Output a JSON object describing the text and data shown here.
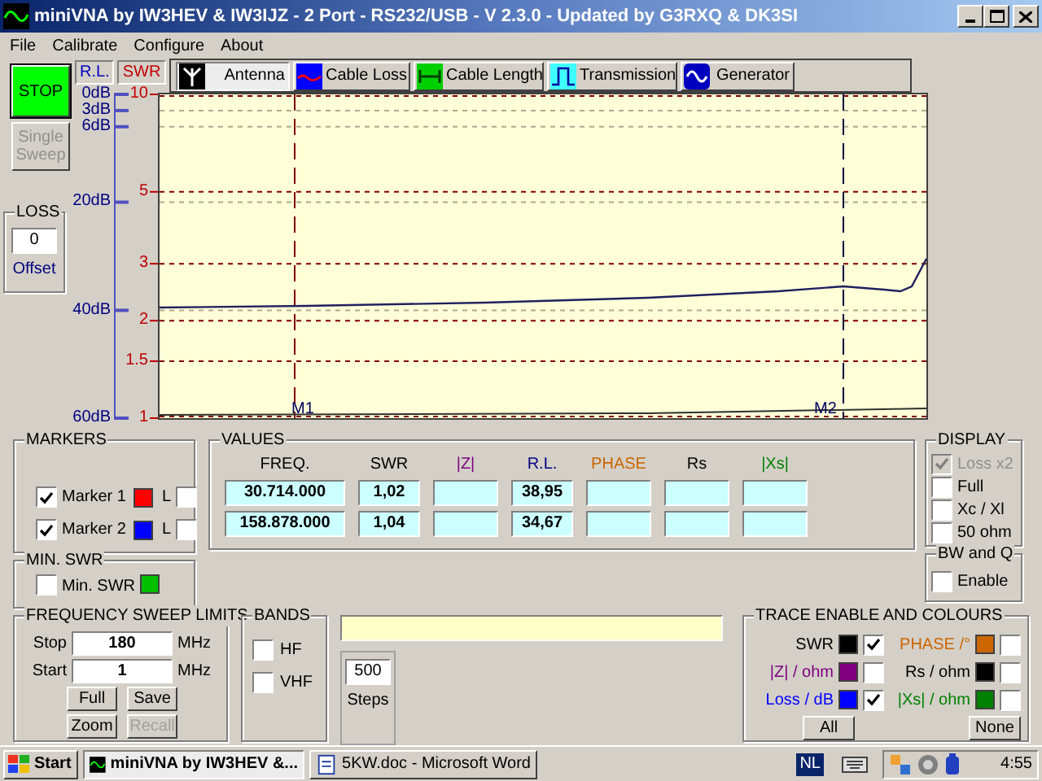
{
  "window": {
    "title": "miniVNA by IW3HEV & IW3IJZ - 2 Port - RS232/USB - V 2.3.0 - Updated by G3RXQ & DK3SI"
  },
  "menu": [
    "File",
    "Calibrate",
    "Configure",
    "About"
  ],
  "stop_button": "STOP",
  "single_sweep": {
    "label": "Single Sweep",
    "disabled": true
  },
  "loss": {
    "title": "LOSS",
    "value": "0",
    "caption": "Offset"
  },
  "scale_buttons": [
    {
      "label": "R.L.",
      "color": "#0000c0"
    },
    {
      "label": "SWR",
      "color": "#c00000"
    }
  ],
  "tabs": [
    {
      "label": "Antenna",
      "kind": "antenna",
      "selected": true
    },
    {
      "label": "Cable Loss",
      "kind": "loss",
      "selected": false
    },
    {
      "label": "Cable Length",
      "kind": "length",
      "selected": false
    },
    {
      "label": "Transmission",
      "kind": "transmission",
      "selected": false
    },
    {
      "label": "Generator",
      "kind": "generator",
      "selected": false
    }
  ],
  "chart": {
    "rl_ticks": [
      "0dB",
      "3dB",
      "6dB",
      "20dB",
      "40dB",
      "60dB"
    ],
    "swr_ticks": [
      "10",
      "5",
      "3",
      "2",
      "1.5",
      "1"
    ],
    "markers": [
      "M1",
      "M2"
    ]
  },
  "markers": {
    "title": "MARKERS",
    "items": [
      {
        "label": "Marker 1",
        "checked": true,
        "color": "#ff0000",
        "l_label": "L",
        "l_checked": false
      },
      {
        "label": "Marker 2",
        "checked": true,
        "color": "#0000ff",
        "l_label": "L",
        "l_checked": false
      }
    ]
  },
  "min_swr": {
    "title": "MIN. SWR",
    "label": "Min. SWR",
    "checked": false,
    "color": "#00c000"
  },
  "values": {
    "title": "VALUES",
    "columns": [
      {
        "label": "FREQ.",
        "color": "#000000"
      },
      {
        "label": "SWR",
        "color": "#000000"
      },
      {
        "label": "|Z|",
        "color": "#800080"
      },
      {
        "label": "R.L.",
        "color": "#000080"
      },
      {
        "label": "PHASE",
        "color": "#cc6600"
      },
      {
        "label": "Rs",
        "color": "#000000"
      },
      {
        "label": "|Xs|",
        "color": "#008000"
      }
    ],
    "rows": [
      [
        "30.714.000",
        "1,02",
        null,
        "38,95",
        null,
        null,
        null
      ],
      [
        "158.878.000",
        "1,04",
        null,
        "34,67",
        null,
        null,
        null
      ]
    ]
  },
  "display": {
    "title": "DISPLAY",
    "items": [
      {
        "label": "Loss x2",
        "checked": true,
        "disabled": true
      },
      {
        "label": "Full",
        "checked": false,
        "disabled": false
      },
      {
        "label": "Xc / Xl",
        "checked": false,
        "disabled": false
      },
      {
        "label": "50 ohm",
        "checked": false,
        "disabled": false
      }
    ]
  },
  "bw_q": {
    "title": "BW and Q",
    "label": "Enable",
    "checked": false
  },
  "sweep": {
    "title": "FREQUENCY SWEEP LIMITS",
    "fields": [
      {
        "label": "Stop",
        "value": "180",
        "unit": "MHz"
      },
      {
        "label": "Start",
        "value": "1",
        "unit": "MHz"
      }
    ],
    "buttons": [
      {
        "label": "Full",
        "disabled": false
      },
      {
        "label": "Save",
        "disabled": false
      },
      {
        "label": "Zoom",
        "disabled": false
      },
      {
        "label": "Recall",
        "disabled": true
      }
    ]
  },
  "bands": {
    "title": "BANDS",
    "items": [
      {
        "label": "HF",
        "checked": false
      },
      {
        "label": "VHF",
        "checked": false
      }
    ]
  },
  "steps": {
    "value": "500",
    "label": "Steps"
  },
  "trace": {
    "title": "TRACE ENABLE AND COLOURS",
    "items": [
      {
        "label": "SWR",
        "color": "#000000",
        "checked": true
      },
      {
        "label": "PHASE /°",
        "color": "#cc6600",
        "checked": false
      },
      {
        "label": "|Z| / ohm",
        "color": "#800080",
        "checked": false
      },
      {
        "label": "Rs / ohm",
        "color": "#000000",
        "checked": false
      },
      {
        "label": "Loss / dB",
        "color": "#0000ff",
        "checked": true
      },
      {
        "label": "|Xs| / ohm",
        "color": "#008000",
        "checked": false
      }
    ],
    "buttons": [
      "All",
      "None"
    ]
  },
  "taskbar": {
    "start": "Start",
    "tasks": [
      {
        "label": "miniVNA by IW3HEV &...",
        "kind": "vna",
        "selected": true
      },
      {
        "label": "5KW.doc - Microsoft Word",
        "kind": "word",
        "selected": false
      }
    ],
    "language": "NL",
    "clock": "4:55"
  }
}
